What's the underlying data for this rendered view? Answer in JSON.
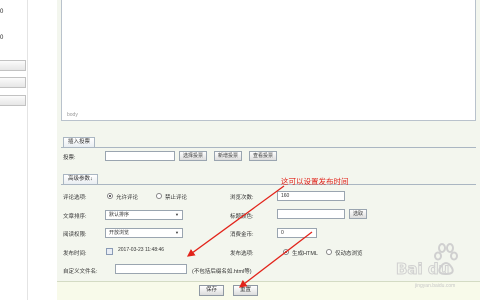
{
  "sidebar": {
    "numbers": [
      "0",
      "0"
    ]
  },
  "editor": {
    "path": "body"
  },
  "insert_section": {
    "tab_label": "插入投票",
    "vote_label": "投票:",
    "vote_value": "",
    "buttons": [
      "选择投票",
      "新增投票",
      "查看投票"
    ]
  },
  "advanced_section": {
    "tab_label": "高级参数↓",
    "comment_label": "评论选项:",
    "comment_options": [
      "允许评论",
      "禁止评论"
    ],
    "comment_selected": 0,
    "views_label": "浏览次数:",
    "views_value": "160",
    "recommend_label": "文章排序:",
    "recommend_value": "默认排序",
    "title_color_label": "标题颜色:",
    "title_color_value": "",
    "title_color_button": "选取",
    "read_label": "阅读权限:",
    "read_value": "开放浏览",
    "cost_label": "消费金币:",
    "cost_value": "0",
    "pubtime_label": "发布时间:",
    "pubtime_value": "2017-03-23 11:48:46",
    "publish_label": "发布选项:",
    "publish_options": [
      "生成HTML",
      "仅动态浏览"
    ],
    "publish_selected": 0,
    "filename_label": "自定义文件名:",
    "filename_value": "",
    "filename_hint": "(不包括后缀名如.html等)"
  },
  "annotation": {
    "text": "这可以设置发布时间",
    "color": "#e2231a"
  },
  "footer": {
    "save_label": "保存",
    "reset_label": "重置"
  },
  "watermark": {
    "brand": "Bai du",
    "sub": "jingyan.baidu.com"
  }
}
